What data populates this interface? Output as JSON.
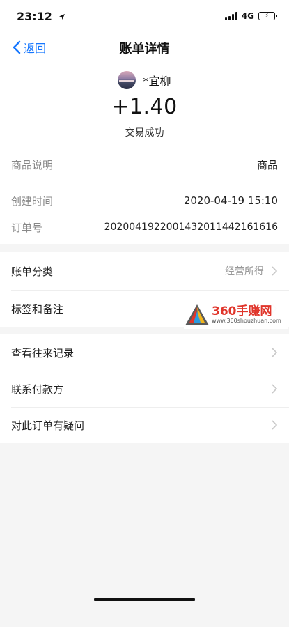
{
  "status_bar": {
    "time": "23:12",
    "network": "4G"
  },
  "nav": {
    "back_label": "返回",
    "title": "账单详情"
  },
  "header": {
    "payer_name": "*宜柳",
    "amount": "+1.40",
    "status": "交易成功"
  },
  "details": {
    "product_label": "商品说明",
    "product_value": "商品",
    "created_label": "创建时间",
    "created_value": "2020-04-19 15:10",
    "order_label": "订单号",
    "order_value": "2020041922001432011442161616"
  },
  "category": {
    "category_label": "账单分类",
    "category_value": "经营所得",
    "tags_label": "标签和备注"
  },
  "actions": {
    "history_label": "查看往来记录",
    "contact_label": "联系付款方",
    "question_label": "对此订单有疑问"
  },
  "watermark": {
    "brand": "360手赚网",
    "url": "www.360shouzhuan.com"
  },
  "colors": {
    "accent": "#1677ff",
    "background": "#f5f5f5"
  },
  "icons": [
    "location-arrow-icon",
    "signal-icon",
    "battery-charging-icon",
    "back-chevron-icon",
    "chevron-right-icon"
  ]
}
